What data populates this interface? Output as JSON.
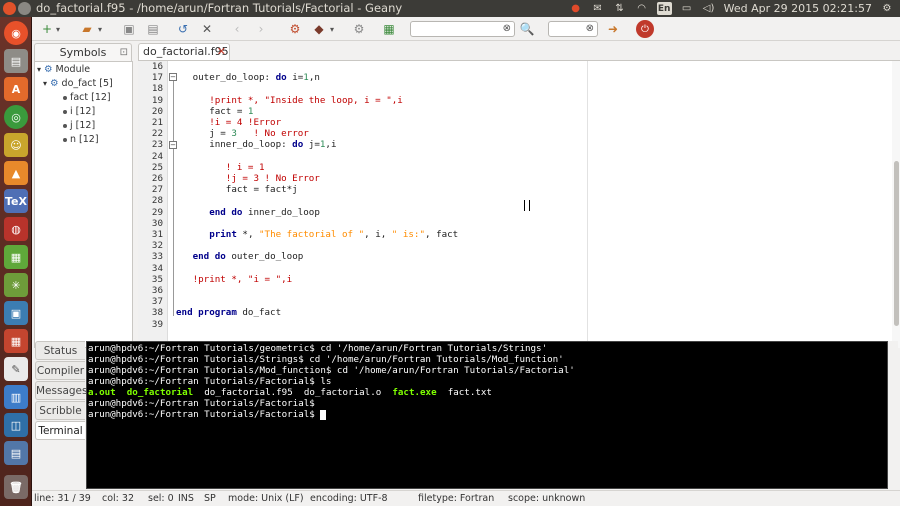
{
  "window": {
    "title": "do_factorial.f95 - /home/arun/Fortran Tutorials/Factorial - Geany"
  },
  "tray": {
    "keyboard": "En",
    "datetime": "Wed Apr 29 2015 02:21:57"
  },
  "toolbar": {
    "search_placeholder": "",
    "goto_placeholder": ""
  },
  "sidebar": {
    "tab_label": "Symbols",
    "tree": {
      "root": "Module",
      "child": "do_fact [5]",
      "items": [
        "fact [12]",
        "i [12]",
        "j [12]",
        "n [12]"
      ]
    }
  },
  "editor": {
    "tab_label": "do_factorial.f95",
    "line_numbers": [
      "16",
      "17",
      "18",
      "19",
      "20",
      "21",
      "22",
      "23",
      "24",
      "25",
      "26",
      "27",
      "28",
      "29",
      "30",
      "31",
      "32",
      "33",
      "34",
      "35",
      "36",
      "37",
      "38",
      "39"
    ]
  },
  "bottom_tabs": [
    "Status",
    "Compiler",
    "Messages",
    "Scribble",
    "Terminal"
  ],
  "terminal": {
    "lines": [
      "arun@hpdv6:~/Fortran Tutorials/geometric$ cd '/home/arun/Fortran Tutorials/Strings'",
      "arun@hpdv6:~/Fortran Tutorials/Strings$ cd '/home/arun/Fortran Tutorials/Mod_function'",
      "arun@hpdv6:~/Fortran Tutorials/Mod_function$ cd '/home/arun/Fortran Tutorials/Factorial'",
      "arun@hpdv6:~/Fortran Tutorials/Factorial$ ls"
    ],
    "ls_output": {
      "a_out": "a.out",
      "do_factorial": "do_factorial",
      "f95": "do_factorial.f95",
      "obj": "do_factorial.o",
      "exe": "fact.exe",
      "txt": "fact.txt"
    },
    "prompt1": "arun@hpdv6:~/Fortran Tutorials/Factorial$",
    "prompt2": "arun@hpdv6:~/Fortran Tutorials/Factorial$ "
  },
  "status": {
    "line": "line: 31 / 39",
    "col": "col: 32",
    "sel": "sel: 0",
    "ins": "INS",
    "sp": "SP",
    "mode": "mode: Unix (LF)",
    "encoding": "encoding: UTF-8",
    "filetype": "filetype: Fortran",
    "scope": "scope: unknown"
  },
  "colors": {
    "keyword": "#00008b",
    "comment": "#c00000",
    "string": "#ff8c00",
    "number": "#2e8b57",
    "terminal_bg": "#000000",
    "terminal_exec": "#7fff00"
  }
}
